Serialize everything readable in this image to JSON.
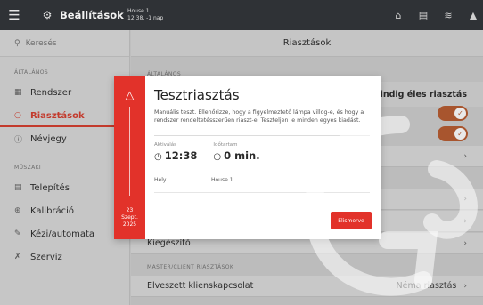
{
  "topbar": {
    "title": "Beállítások",
    "house_name": "House 1",
    "house_sub": "12:38, -1 nap",
    "icons": [
      "home-icon",
      "document-icon",
      "signal-icon",
      "alarm-bell-icon"
    ]
  },
  "sidebar": {
    "search_placeholder": "Keresés",
    "section_general": "ÁLTALÁNOS",
    "section_technical": "MŰSZAKI",
    "items_general": [
      {
        "label": "Rendszer",
        "icon": "grid-icon"
      },
      {
        "label": "Riasztások",
        "icon": "bell-icon",
        "active": true
      },
      {
        "label": "Névjegy",
        "icon": "info-icon"
      }
    ],
    "items_technical": [
      {
        "label": "Telepítés",
        "icon": "install-icon"
      },
      {
        "label": "Kalibráció",
        "icon": "crosshair-icon"
      },
      {
        "label": "Kézi/automata",
        "icon": "hand-icon"
      },
      {
        "label": "Szerviz",
        "icon": "tools-icon"
      }
    ]
  },
  "main": {
    "title": "Riasztások",
    "section_general": "ÁLTALÁNOS",
    "mindig_label": "Mindig éles riasztás",
    "kiegeszito_label": "Kiegészítő",
    "section_master": "MASTER/CLIENT RIASZTÁSOK",
    "lost_client_label": "Elveszett klienskapcsolat",
    "lost_client_value": "Néma riasztás",
    "toggles_on": [
      true,
      true
    ]
  },
  "modal": {
    "title": "Tesztriasztás",
    "description": "Manuális teszt. Ellenőrizze, hogy a figyelmeztető lámpa villog-e, és hogy a rendszer rendeltetésszerűen riaszt-e. Teszteljen le minden egyes kiadást.",
    "activated_label": "Aktiválás",
    "activated_value": "12:38",
    "duration_label": "Időtartam",
    "duration_value": "0 min.",
    "location_label": "Hely",
    "location_value": "House 1",
    "date_day": "23",
    "date_month": "Szept.",
    "date_year": "2025",
    "button_label": "Elismerve"
  },
  "colors": {
    "accent": "#e2322a",
    "sidebar_active": "#c33a2c",
    "toggle": "#a8552e",
    "topbar": "#2f3236"
  }
}
